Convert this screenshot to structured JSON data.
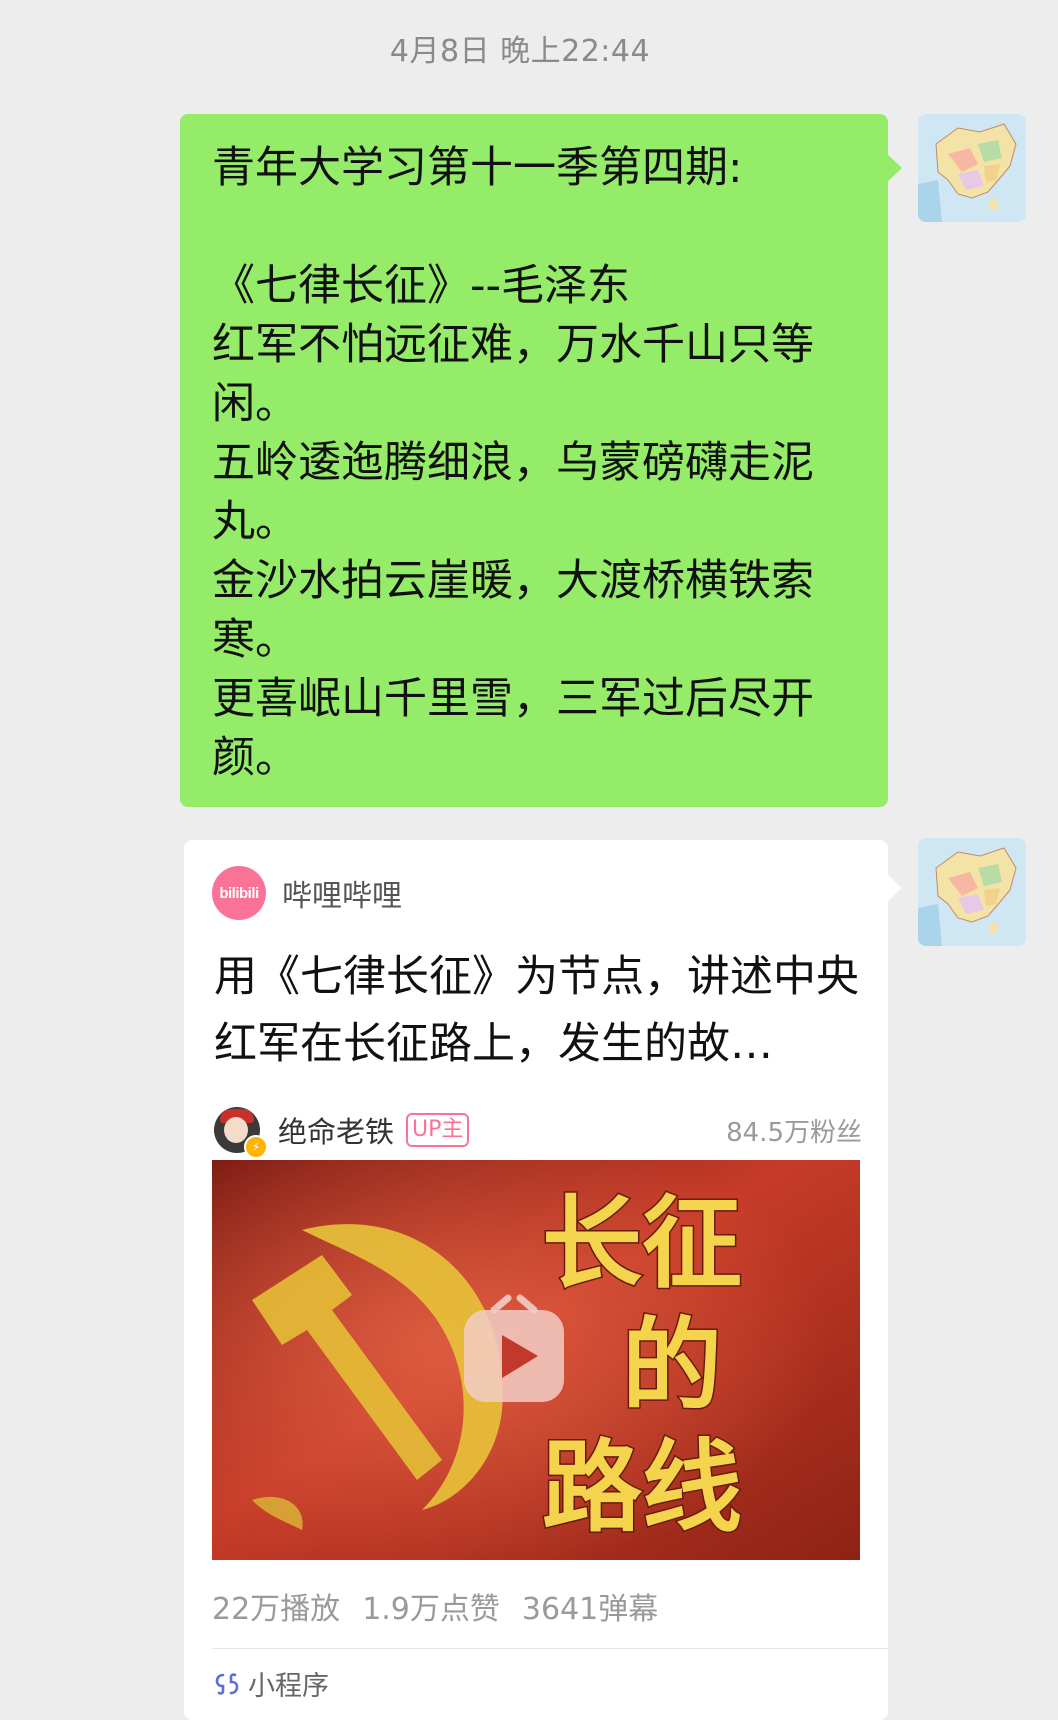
{
  "timestamp": "4月8日 晚上22:44",
  "message": {
    "lines": [
      "青年大学习第十一季第四期:",
      "",
      "《七律长征》--毛泽东",
      "红军不怕远征难，万水千山只等闲。",
      "五岭逶迤腾细浪，乌蒙磅礴走泥丸。",
      "金沙水拍云崖暖，大渡桥横铁索寒。",
      "更喜岷山千里雪，三军过后尽开颜。"
    ]
  },
  "card": {
    "app_logo_text": "bilibili",
    "app_name": "哔哩哔哩",
    "title": "用《七律长征》为节点，讲述中央红军在长征路上，发生的故…",
    "uploader": {
      "name": "绝命老铁",
      "tag": "UP主",
      "fans": "84.5万粉丝"
    },
    "thumbnail": {
      "overlay_text": [
        "长征",
        "的",
        "路线"
      ]
    },
    "stats": {
      "plays": "22万播放",
      "likes": "1.9万点赞",
      "danmaku": "3641弹幕"
    },
    "footer_label": "小程序"
  },
  "colors": {
    "bubble_green": "#95ec69",
    "background": "#ededed",
    "bili_pink": "#fb7299"
  },
  "icons": {
    "avatar": "china-map-avatar",
    "play": "play-icon",
    "mini_program": "mini-program-icon"
  }
}
